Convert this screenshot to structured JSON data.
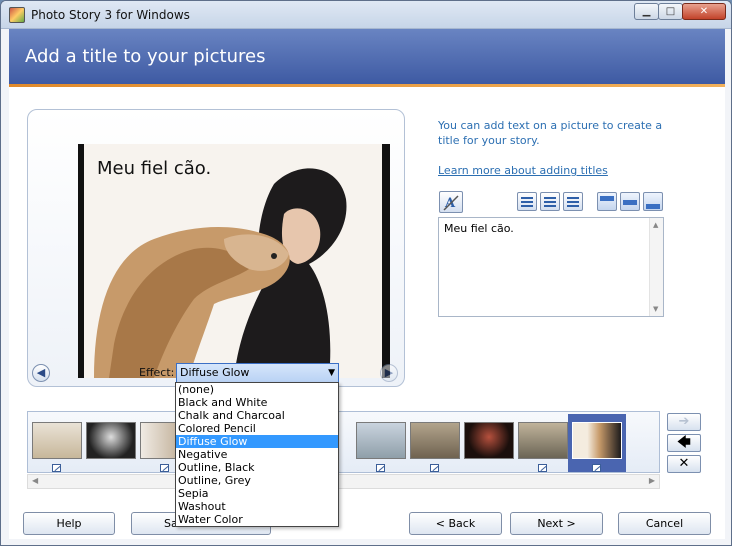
{
  "window": {
    "title": "Photo Story 3 for Windows",
    "controls": {
      "minimize": "▁",
      "maximize": "□",
      "close": "✕"
    }
  },
  "header": {
    "title": "Add a title to your pictures"
  },
  "preview": {
    "photo_text": "Meu fiel cão.",
    "effect_label": "Effect:",
    "effect_value": "Diffuse Glow",
    "prev_icon": "◀",
    "next_icon": "▶"
  },
  "help": {
    "text": "You can add text on a picture to create a title for your story.",
    "link": "Learn more about adding titles"
  },
  "text_box": {
    "value": "Meu fiel cão."
  },
  "effect_options": [
    "(none)",
    "Black and White",
    "Chalk and Charcoal",
    "Colored Pencil",
    "Diffuse Glow",
    "Negative",
    "Outline, Black",
    "Outline, Grey",
    "Sepia",
    "Washout",
    "Water Color"
  ],
  "effect_selected_index": 4,
  "filmstrip": {
    "right_arrow": "➔",
    "left_arrow": "🡄",
    "remove": "✕"
  },
  "buttons": {
    "help": "Help",
    "save": "Sa",
    "back": "< Back",
    "next": "Next >",
    "cancel": "Cancel"
  },
  "colors": {
    "header": "#4a66ad",
    "accent_rule": "#e08a2b",
    "link": "#2c6fb2",
    "selection": "#3399ff"
  }
}
